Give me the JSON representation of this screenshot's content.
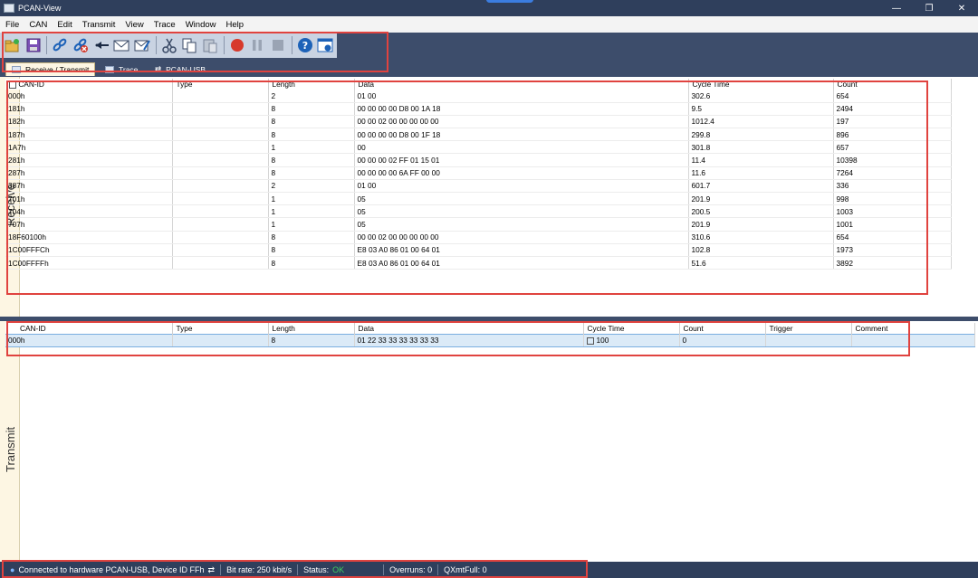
{
  "window": {
    "title": "PCAN-View"
  },
  "menu": [
    "File",
    "CAN",
    "Edit",
    "Transmit",
    "View",
    "Trace",
    "Window",
    "Help"
  ],
  "toolbar": {
    "icons": [
      "connect-open-icon",
      "save-icon",
      "connect-icon",
      "disconnect-icon",
      "reset-icon",
      "new-message-icon",
      "edit-message-icon",
      "cut-icon",
      "copy-icon",
      "paste-icon",
      "record-icon",
      "pause-icon",
      "stop-icon",
      "help-icon",
      "about-icon"
    ]
  },
  "tabs": [
    {
      "label": "Receive / Transmit",
      "active": true
    },
    {
      "label": "Trace",
      "active": false
    },
    {
      "label": "PCAN-USB",
      "active": false
    }
  ],
  "receive": {
    "side_label": "Receive",
    "columns": [
      "CAN-ID",
      "Type",
      "Length",
      "Data",
      "Cycle Time",
      "Count"
    ],
    "rows": [
      [
        "000h",
        "",
        "2",
        "01 00",
        "302.6",
        "654"
      ],
      [
        "181h",
        "",
        "8",
        "00 00 00 00 D8 00 1A 18",
        "9.5",
        "2494"
      ],
      [
        "182h",
        "",
        "8",
        "00 00 02 00 00 00 00 00",
        "1012.4",
        "197"
      ],
      [
        "187h",
        "",
        "8",
        "00 00 00 00 D8 00 1F 18",
        "299.8",
        "896"
      ],
      [
        "1A7h",
        "",
        "1",
        "00",
        "301.8",
        "657"
      ],
      [
        "281h",
        "",
        "8",
        "00 00 00 02 FF 01 15 01",
        "11.4",
        "10398"
      ],
      [
        "287h",
        "",
        "8",
        "00 00 00 00 6A FF 00 00",
        "11.6",
        "7264"
      ],
      [
        "387h",
        "",
        "2",
        "01 00",
        "601.7",
        "336"
      ],
      [
        "701h",
        "",
        "1",
        "05",
        "201.9",
        "998"
      ],
      [
        "704h",
        "",
        "1",
        "05",
        "200.5",
        "1003"
      ],
      [
        "707h",
        "",
        "1",
        "05",
        "201.9",
        "1001"
      ],
      [
        "18F60100h",
        "",
        "8",
        "00 00 02 00 00 00 00 00",
        "310.6",
        "654"
      ],
      [
        "1C00FFFCh",
        "",
        "8",
        "E8 03 A0 86 01 00 64 01",
        "102.8",
        "1973"
      ],
      [
        "1C00FFFFh",
        "",
        "8",
        "E8 03 A0 86 01 00 64 01",
        "51.6",
        "3892"
      ]
    ]
  },
  "transmit": {
    "side_label": "Transmit",
    "columns": [
      "CAN-ID",
      "Type",
      "Length",
      "Data",
      "Cycle Time",
      "Count",
      "Trigger",
      "Comment"
    ],
    "rows": [
      [
        "000h",
        "",
        "8",
        "01 22 33 33 33 33 33 33",
        "100",
        "0",
        "",
        ""
      ]
    ]
  },
  "status": {
    "connection": "Connected to hardware PCAN-USB, Device ID FFh",
    "bitrate": "Bit rate: 250 kbit/s",
    "status_label": "Status:",
    "status_value": "OK",
    "overruns": "Overruns: 0",
    "qxmtfull": "QXmtFull: 0"
  },
  "colors": {
    "highlight_box": "#e0433f",
    "status_ok": "#3ecf5e",
    "chrome": "#3d4d6b"
  }
}
